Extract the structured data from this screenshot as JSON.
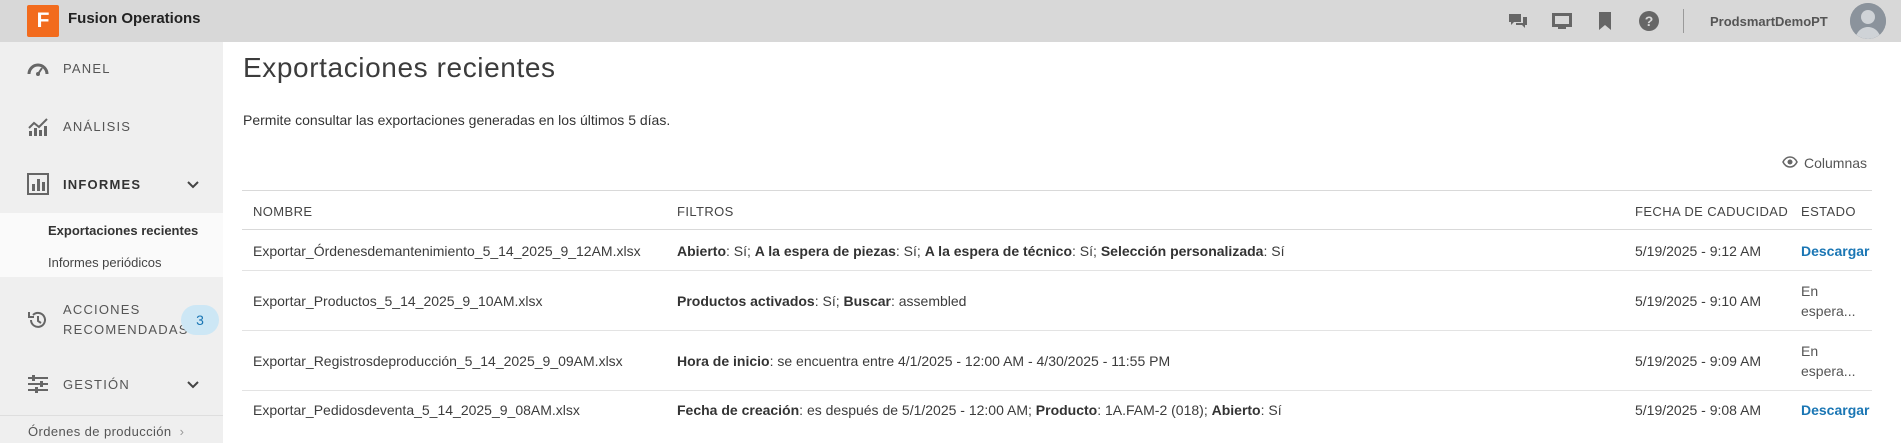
{
  "app": {
    "logo_letter": "F",
    "title": "Fusion Operations"
  },
  "topbar": {
    "user_name": "ProdsmartDemoPT"
  },
  "sidebar": {
    "items": [
      {
        "label": "PANEL"
      },
      {
        "label": "ANÁLISIS"
      },
      {
        "label": "INFORMES"
      },
      {
        "label": "ACCIONES",
        "label2": "RECOMENDADAS",
        "badge": "3"
      },
      {
        "label": "GESTIÓN"
      }
    ],
    "subitems": [
      {
        "label": "Exportaciones recientes"
      },
      {
        "label": "Informes periódicos"
      }
    ],
    "link": "Órdenes de producción"
  },
  "main": {
    "title": "Exportaciones recientes",
    "description": "Permite consultar las exportaciones generadas en los últimos 5 días.",
    "columns_button": "Columnas"
  },
  "table": {
    "headers": [
      "NOMBRE",
      "FILTROS",
      "FECHA DE CADUCIDAD",
      "ESTADO"
    ],
    "rows": [
      {
        "name": "Exportar_Órdenesdemantenimiento_5_14_2025_9_12AM.xlsx",
        "filters": [
          {
            "k": "Abierto",
            "v": ": Sí; "
          },
          {
            "k": "A la espera de piezas",
            "v": ": Sí; "
          },
          {
            "k": "A la espera de técnico",
            "v": ": Sí; "
          },
          {
            "k": "Selección personalizada",
            "v": ": Sí"
          }
        ],
        "date": "5/19/2025 - 9:12 AM",
        "status": "Descargar"
      },
      {
        "name": "Exportar_Productos_5_14_2025_9_10AM.xlsx",
        "filters": [
          {
            "k": "Productos activados",
            "v": ": Sí; "
          },
          {
            "k": "Buscar",
            "v": ": assembled"
          }
        ],
        "date": "5/19/2025 - 9:10 AM",
        "status_line1": "En",
        "status_line2": "espera..."
      },
      {
        "name": "Exportar_Registrosdeproducción_5_14_2025_9_09AM.xlsx",
        "filters": [
          {
            "k": "Hora de inicio",
            "v": ": se encuentra entre 4/1/2025 - 12:00 AM - 4/30/2025 - 11:55 PM"
          }
        ],
        "date": "5/19/2025 - 9:09 AM",
        "status_line1": "En",
        "status_line2": "espera..."
      },
      {
        "name": "Exportar_Pedidosdeventa_5_14_2025_9_08AM.xlsx",
        "filters": [
          {
            "k": "Fecha de creación",
            "v": ": es después de 5/1/2025 - 12:00 AM; "
          },
          {
            "k": "Producto",
            "v": ": 1A.FAM-2 (018); "
          },
          {
            "k": "Abierto",
            "v": ": Sí"
          }
        ],
        "date": "5/19/2025 - 9:08 AM",
        "status": "Descargar"
      }
    ]
  }
}
